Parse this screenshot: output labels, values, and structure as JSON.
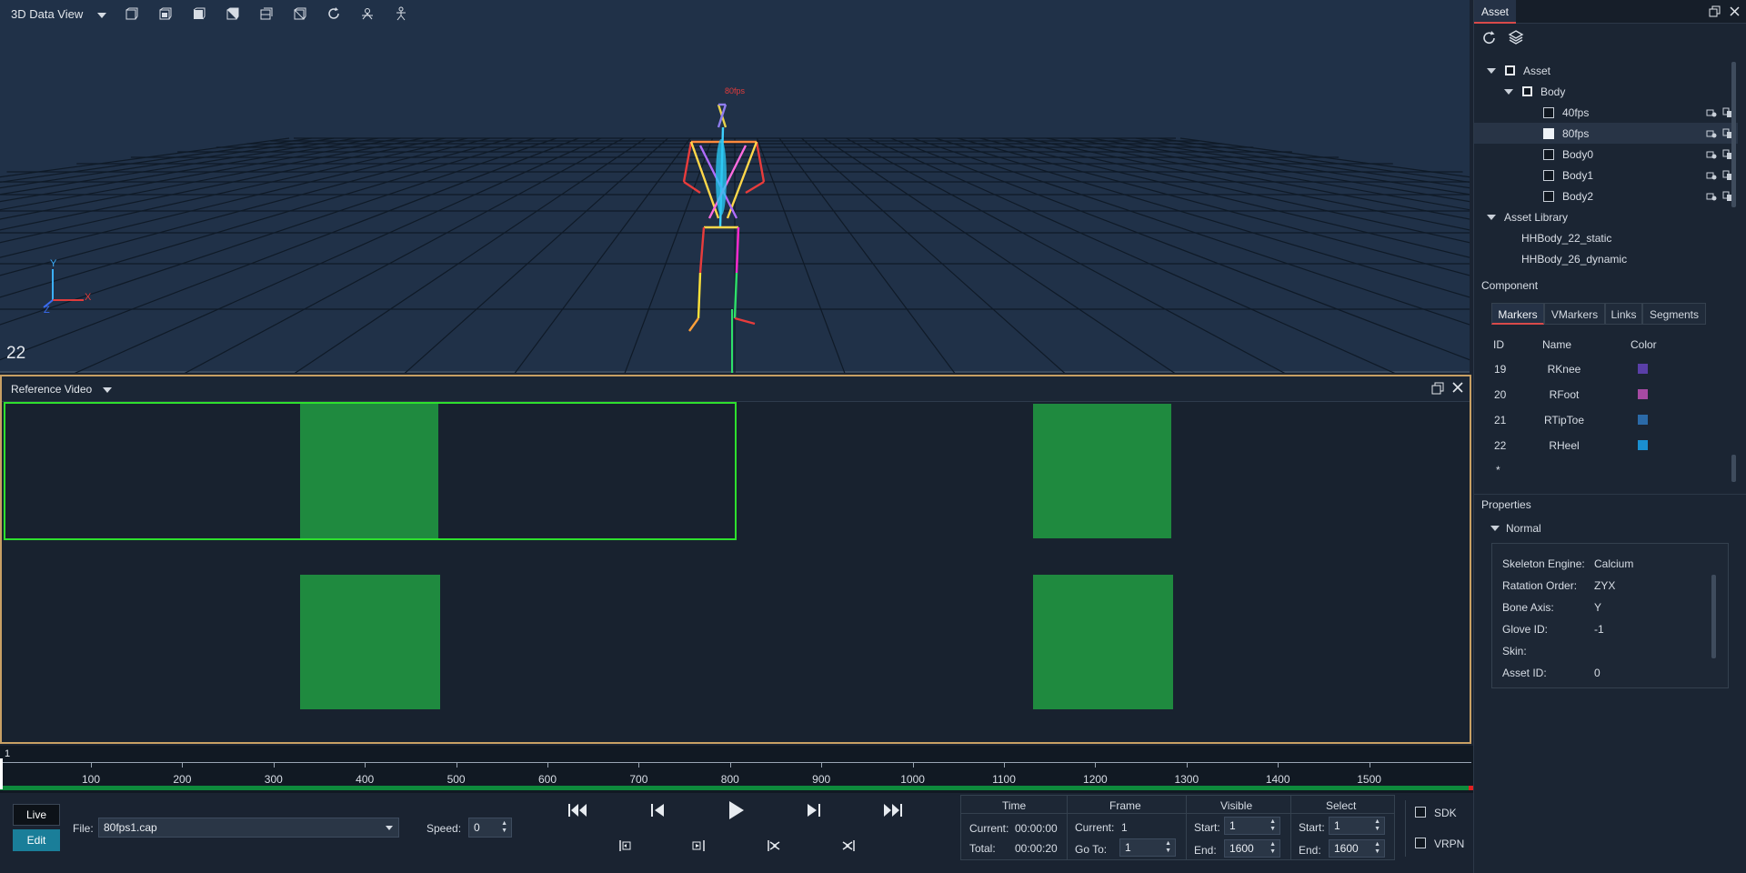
{
  "viewport": {
    "title": "3D Data View",
    "frame_counter": "22",
    "skeleton_label": "80fps",
    "axis": {
      "x": "X",
      "y": "Y",
      "z": "Z"
    },
    "toolbar_icons": [
      "view-cube-1-icon",
      "view-cube-2-icon",
      "view-cube-3-icon",
      "view-cube-4-icon",
      "view-cube-5-icon",
      "view-cube-6-icon",
      "refresh-icon",
      "camera-rig-icon",
      "skeleton-icon"
    ]
  },
  "reference_video": {
    "title": "Reference Video"
  },
  "timeline": {
    "start_label": "1",
    "ticks": [
      "100",
      "200",
      "300",
      "400",
      "500",
      "600",
      "700",
      "800",
      "900",
      "1000",
      "1100",
      "1200",
      "1300",
      "1400",
      "1500"
    ]
  },
  "controls": {
    "live_label": "Live",
    "edit_label": "Edit",
    "file_label": "File:",
    "file_value": "80fps1.cap",
    "speed_label": "Speed:",
    "speed_value": "0",
    "time": {
      "header": "Time",
      "current_label": "Current:",
      "current_value": "00:00:00",
      "total_label": "Total:",
      "total_value": "00:00:20"
    },
    "frame": {
      "header": "Frame",
      "current_label": "Current:",
      "current_value": "1",
      "goto_label": "Go To:",
      "goto_value": "1"
    },
    "visible": {
      "header": "Visible",
      "start_label": "Start:",
      "start_value": "1",
      "end_label": "End:",
      "end_value": "1600"
    },
    "select": {
      "header": "Select",
      "start_label": "Start:",
      "start_value": "1",
      "end_label": "End:",
      "end_value": "1600"
    },
    "sdk_label": "SDK",
    "vrpn_label": "VRPN"
  },
  "asset_panel": {
    "tab": "Asset",
    "tree": {
      "root": "Asset",
      "body": "Body",
      "items": [
        {
          "label": "40fps",
          "checked": false
        },
        {
          "label": "80fps",
          "checked": true
        },
        {
          "label": "Body0",
          "checked": false
        },
        {
          "label": "Body1",
          "checked": false
        },
        {
          "label": "Body2",
          "checked": false
        }
      ],
      "library": "Asset Library",
      "library_items": [
        "HHBody_22_static",
        "HHBody_26_dynamic"
      ]
    },
    "component": {
      "title": "Component",
      "tabs": [
        "Markers",
        "VMarkers",
        "Links",
        "Segments"
      ],
      "columns": [
        "ID",
        "Name",
        "Color"
      ],
      "rows": [
        {
          "id": "19",
          "name": "RKnee",
          "color": "#5a3fa8"
        },
        {
          "id": "20",
          "name": "RFoot",
          "color": "#a64aa3"
        },
        {
          "id": "21",
          "name": "RTipToe",
          "color": "#2b6aa8"
        },
        {
          "id": "22",
          "name": "RHeel",
          "color": "#1a8fd0"
        }
      ],
      "new_row": "*"
    },
    "properties": {
      "title": "Properties",
      "group": "Normal",
      "fields": [
        {
          "label": "Skeleton Engine:",
          "value": "Calcium"
        },
        {
          "label": "Ratation Order:",
          "value": "ZYX"
        },
        {
          "label": "Bone Axis:",
          "value": "Y"
        },
        {
          "label": "Glove ID:",
          "value": "-1"
        },
        {
          "label": "Skin:",
          "value": ""
        },
        {
          "label": "Asset ID:",
          "value": "0"
        }
      ]
    }
  }
}
